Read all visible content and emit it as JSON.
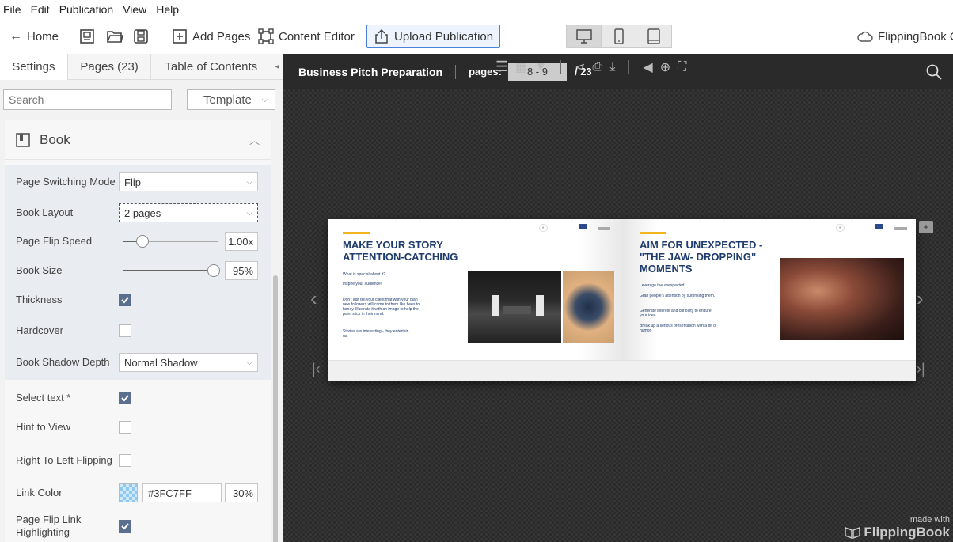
{
  "menu": [
    "File",
    "Edit",
    "Publication",
    "View",
    "Help"
  ],
  "toolbar": {
    "home": "Home",
    "add_pages": "Add Pages",
    "content_editor": "Content Editor",
    "upload": "Upload Publication",
    "cloud": "FlippingBook Cl"
  },
  "left_panel": {
    "tabs": [
      "Settings",
      "Pages (23)",
      "Table of Contents"
    ],
    "search_placeholder": "Search",
    "template_label": "Template",
    "section_title": "Book",
    "settings": {
      "page_switching_mode": {
        "label": "Page Switching Mode",
        "value": "Flip"
      },
      "book_layout": {
        "label": "Book Layout",
        "value": "2 pages"
      },
      "page_flip_speed": {
        "label": "Page Flip Speed",
        "value": "1.00x",
        "fraction": 0.2
      },
      "book_size": {
        "label": "Book Size",
        "value": "95%",
        "fraction": 0.95
      },
      "thickness": {
        "label": "Thickness",
        "checked": true
      },
      "hardcover": {
        "label": "Hardcover",
        "checked": false
      },
      "book_shadow_depth": {
        "label": "Book Shadow Depth",
        "value": "Normal Shadow"
      },
      "select_text": {
        "label": "Select text *",
        "checked": true
      },
      "hint_to_view": {
        "label": "Hint to View",
        "checked": false
      },
      "right_to_left": {
        "label": "Right To Left Flipping",
        "checked": false
      },
      "link_color": {
        "label": "Link Color",
        "hex": "#3FC7FF",
        "opacity": "30%"
      },
      "page_flip_link": {
        "label": "Page Flip Link Highlighting",
        "checked": true
      }
    }
  },
  "viewer": {
    "title": "Business Pitch Preparation",
    "pages_label": "pages:",
    "pages_value": "8 - 9",
    "total": "/ 23",
    "made_with": "made with",
    "brand": "FlippingBook",
    "left_page": {
      "heading": "MAKE YOUR STORY ATTENTION-CATCHING",
      "text1": "What is special about it?",
      "text2": "Inspire your audience!",
      "text3": "Don't just tell your client that with your plan new followers will come to them like bees to honey. Illustrate it with an image to help the point stick in their mind.",
      "text4": "Stories are interesting - they entertain us."
    },
    "right_page": {
      "heading": "AIM FOR UNEXPECTED -\"THE JAW- DROPPING\" MOMENTS",
      "text1": "Leverage the unexpected.",
      "text2": "Grab people's attention by surprising them.",
      "text3": "Generate interest and curiosity to endure your idea.",
      "text4": "Break up a serious presentation with a bit of humor."
    }
  },
  "colors": {
    "accent": "#f2b51d",
    "heading": "#1f3c6e",
    "checkbox": "#5a6f8d",
    "upload_border": "#4a82d8"
  }
}
